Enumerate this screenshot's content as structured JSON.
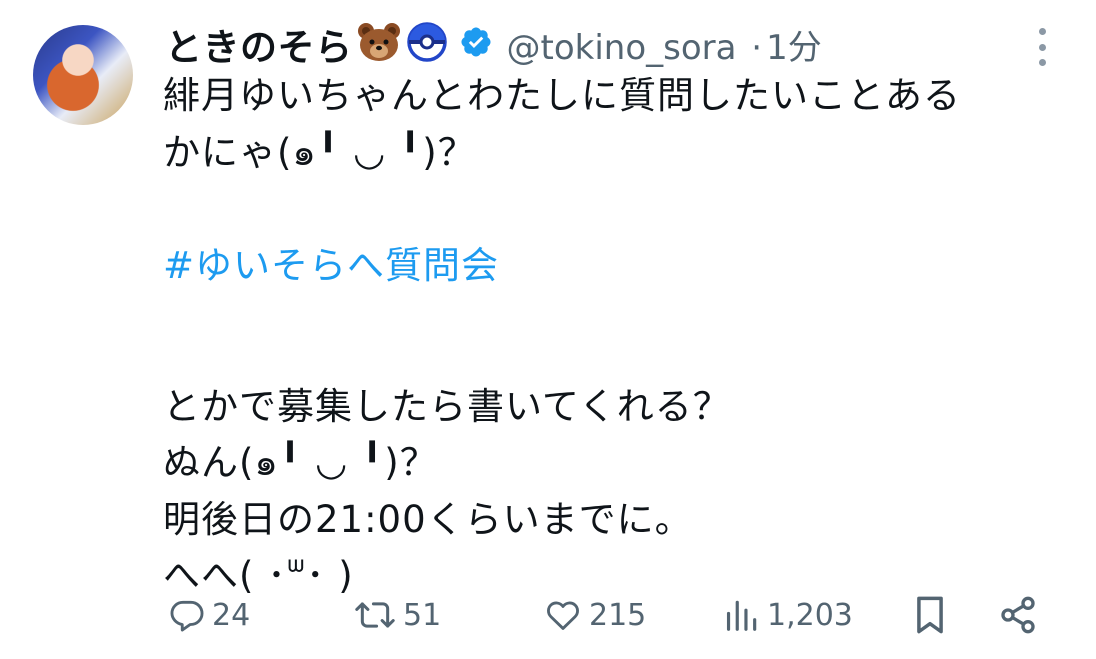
{
  "user": {
    "display_name": "ときのそら",
    "badge_emoji_1": "bear-face-icon",
    "badge_emoji_2": "poke-ball-icon",
    "verified": true,
    "handle": "@tokino_sora",
    "separator": "·",
    "time": "1分"
  },
  "tweet": {
    "line1": "緋月ゆいちゃんとわたしに質問したいことある",
    "line2": "かにゃ(๑╹ ◡ ╹)？",
    "hashtag": "#ゆいそらへ質問会",
    "line4": "とかで募集したら書いてくれる？",
    "line5": "ぬん(๑╹ ◡ ╹)？",
    "line6": "明後日の21:00くらいまでに。",
    "line7": "へへ( ･ᐜ･ )"
  },
  "actions": {
    "replies": "24",
    "retweets": "51",
    "likes": "215",
    "views": "1,203"
  },
  "colors": {
    "accent": "#1d9bf0",
    "muted": "#536471",
    "text": "#0f1419"
  }
}
